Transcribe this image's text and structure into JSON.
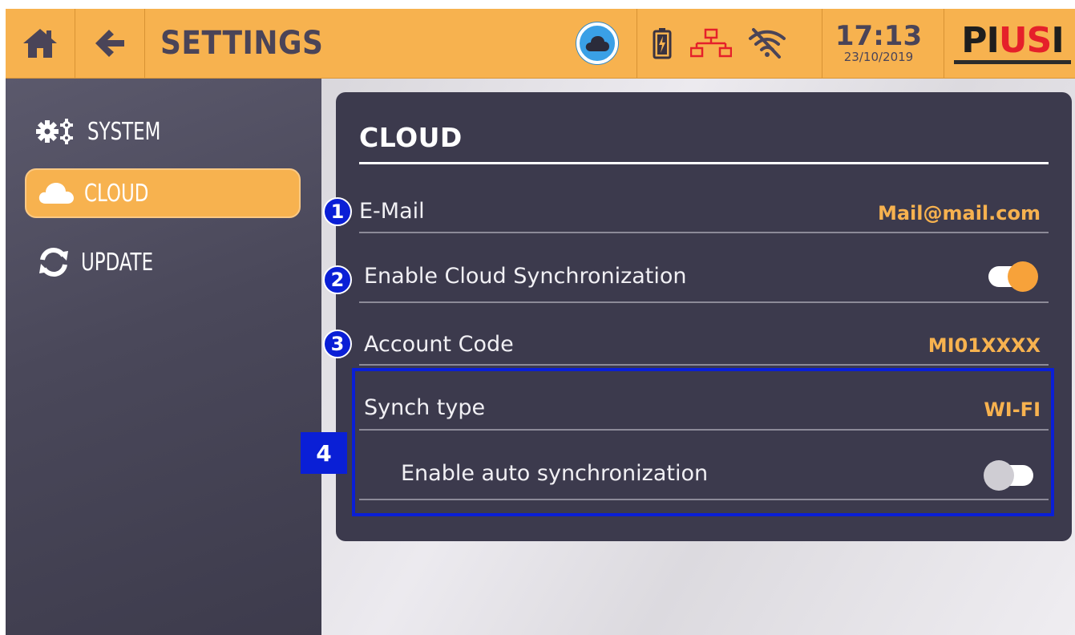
{
  "header": {
    "title": "SETTINGS",
    "time": "17:13",
    "date": "23/10/2019",
    "logo_text_pi": "PI",
    "logo_text_us": "US",
    "logo_text_i": "I",
    "icons": [
      "home-icon",
      "back-arrow-icon",
      "cloud-status-icon",
      "battery-icon",
      "network-icon",
      "wifi-off-icon"
    ]
  },
  "sidebar": {
    "items": [
      {
        "label": "SYSTEM",
        "icon": "gears-icon",
        "active": false
      },
      {
        "label": "CLOUD",
        "icon": "cloud-icon",
        "active": true
      },
      {
        "label": "UPDATE",
        "icon": "refresh-icon",
        "active": false
      }
    ]
  },
  "panel": {
    "title": "CLOUD",
    "rows": [
      {
        "badge": "1",
        "label": "E-Mail",
        "value": "Mail@mail.com"
      },
      {
        "badge": "2",
        "label": "Enable Cloud Synchronization",
        "toggle": true
      },
      {
        "badge": "3",
        "label": "Account Code",
        "value": "MI01XXXX"
      },
      {
        "label": "Synch type",
        "value": "WI-FI"
      },
      {
        "label": "Enable auto synchronization",
        "toggle": false
      }
    ],
    "group_badge": "4"
  },
  "colors": {
    "accent": "#f7b24f",
    "panel": "#3c3a4d",
    "sidebar": "#4a485a",
    "annotation_blue": "#0a1fd6",
    "logo_red": "#e5202a"
  }
}
